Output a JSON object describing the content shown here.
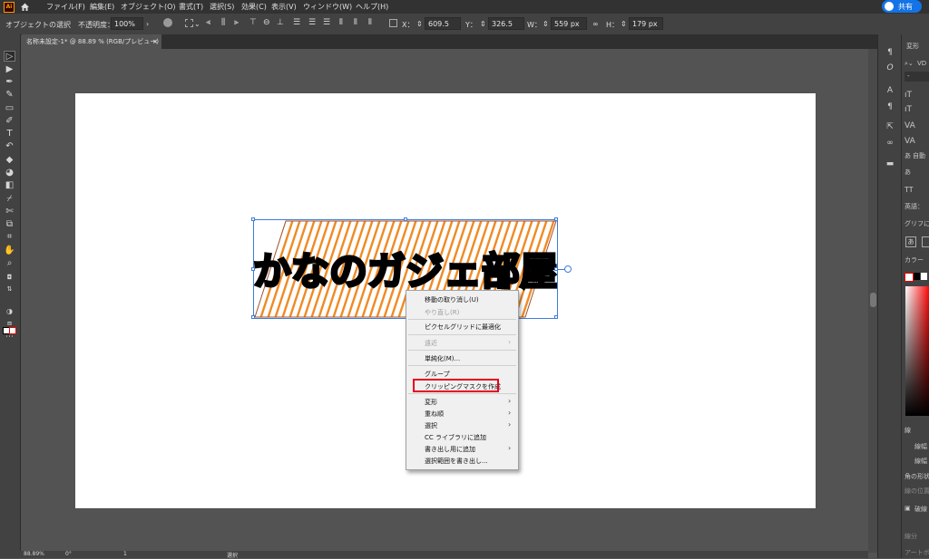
{
  "app": {
    "logo": "Ai"
  },
  "menubar": {
    "items": [
      "ファイル(F)",
      "編集(E)",
      "オブジェクト(O)",
      "書式(T)",
      "選択(S)",
      "効果(C)",
      "表示(V)",
      "ウィンドウ(W)",
      "ヘルプ(H)"
    ],
    "share_label": "共有"
  },
  "control_bar": {
    "object_type": "オブジェクトの選択",
    "opacity_label": "不透明度：",
    "opacity_value": "100%",
    "x_label": "X：",
    "x_value": "609.5 px",
    "y_label": "Y：",
    "y_value": "326.5 px",
    "w_label": "W：",
    "w_value": "559 px",
    "h_label": "H：",
    "h_value": "179 px"
  },
  "document_tab": {
    "title": "名称未設定-1* @ 88.89 % (RGB/プレビュー)",
    "close": "×"
  },
  "artwork": {
    "text": "かなのガジェ部屋",
    "stripe_color": "#f08a24",
    "fill_color": "#000000"
  },
  "context_menu": {
    "items": [
      {
        "label": "移動の取り消し(U)",
        "disabled": false
      },
      {
        "label": "やり直し(R)",
        "disabled": true
      },
      {
        "label": "ピクセルグリッドに最適化",
        "disabled": false
      },
      {
        "label": "遠近",
        "disabled": true,
        "submenu": true
      },
      {
        "label": "単純化(M)...",
        "disabled": false
      },
      {
        "label": "グループ",
        "disabled": false
      },
      {
        "label": "クリッピングマスクを作成",
        "disabled": false,
        "highlighted": true
      },
      {
        "label": "変形",
        "disabled": false,
        "submenu": true
      },
      {
        "label": "重ね順",
        "disabled": false,
        "submenu": true
      },
      {
        "label": "選択",
        "disabled": false,
        "submenu": true
      },
      {
        "label": "CC ライブラリに追加",
        "disabled": false
      },
      {
        "label": "書き出し用に追加",
        "disabled": false,
        "submenu": true
      },
      {
        "label": "選択範囲を書き出し...",
        "disabled": false
      }
    ],
    "highlight_color": "#e8001e"
  },
  "right_panel": {
    "tab_transform": "変形",
    "font_search": "VD",
    "font_style": "-",
    "auto_label": "自動",
    "tt_label": "TT",
    "lang_label": "英語：",
    "glyph_label": "グリフに",
    "color_label": "カラー",
    "stroke_label": "線",
    "stroke_weight_1": "線幅",
    "stroke_weight_2": "線幅",
    "corner_label": "角の形状",
    "align_label": "線の位置",
    "dashed_label": "破線",
    "dash_label": "線分",
    "artboard_label": "アートボ"
  },
  "status_bar": {
    "zoom": "88.89%",
    "angle": "0°",
    "artboard": "1",
    "tool": "選択"
  }
}
